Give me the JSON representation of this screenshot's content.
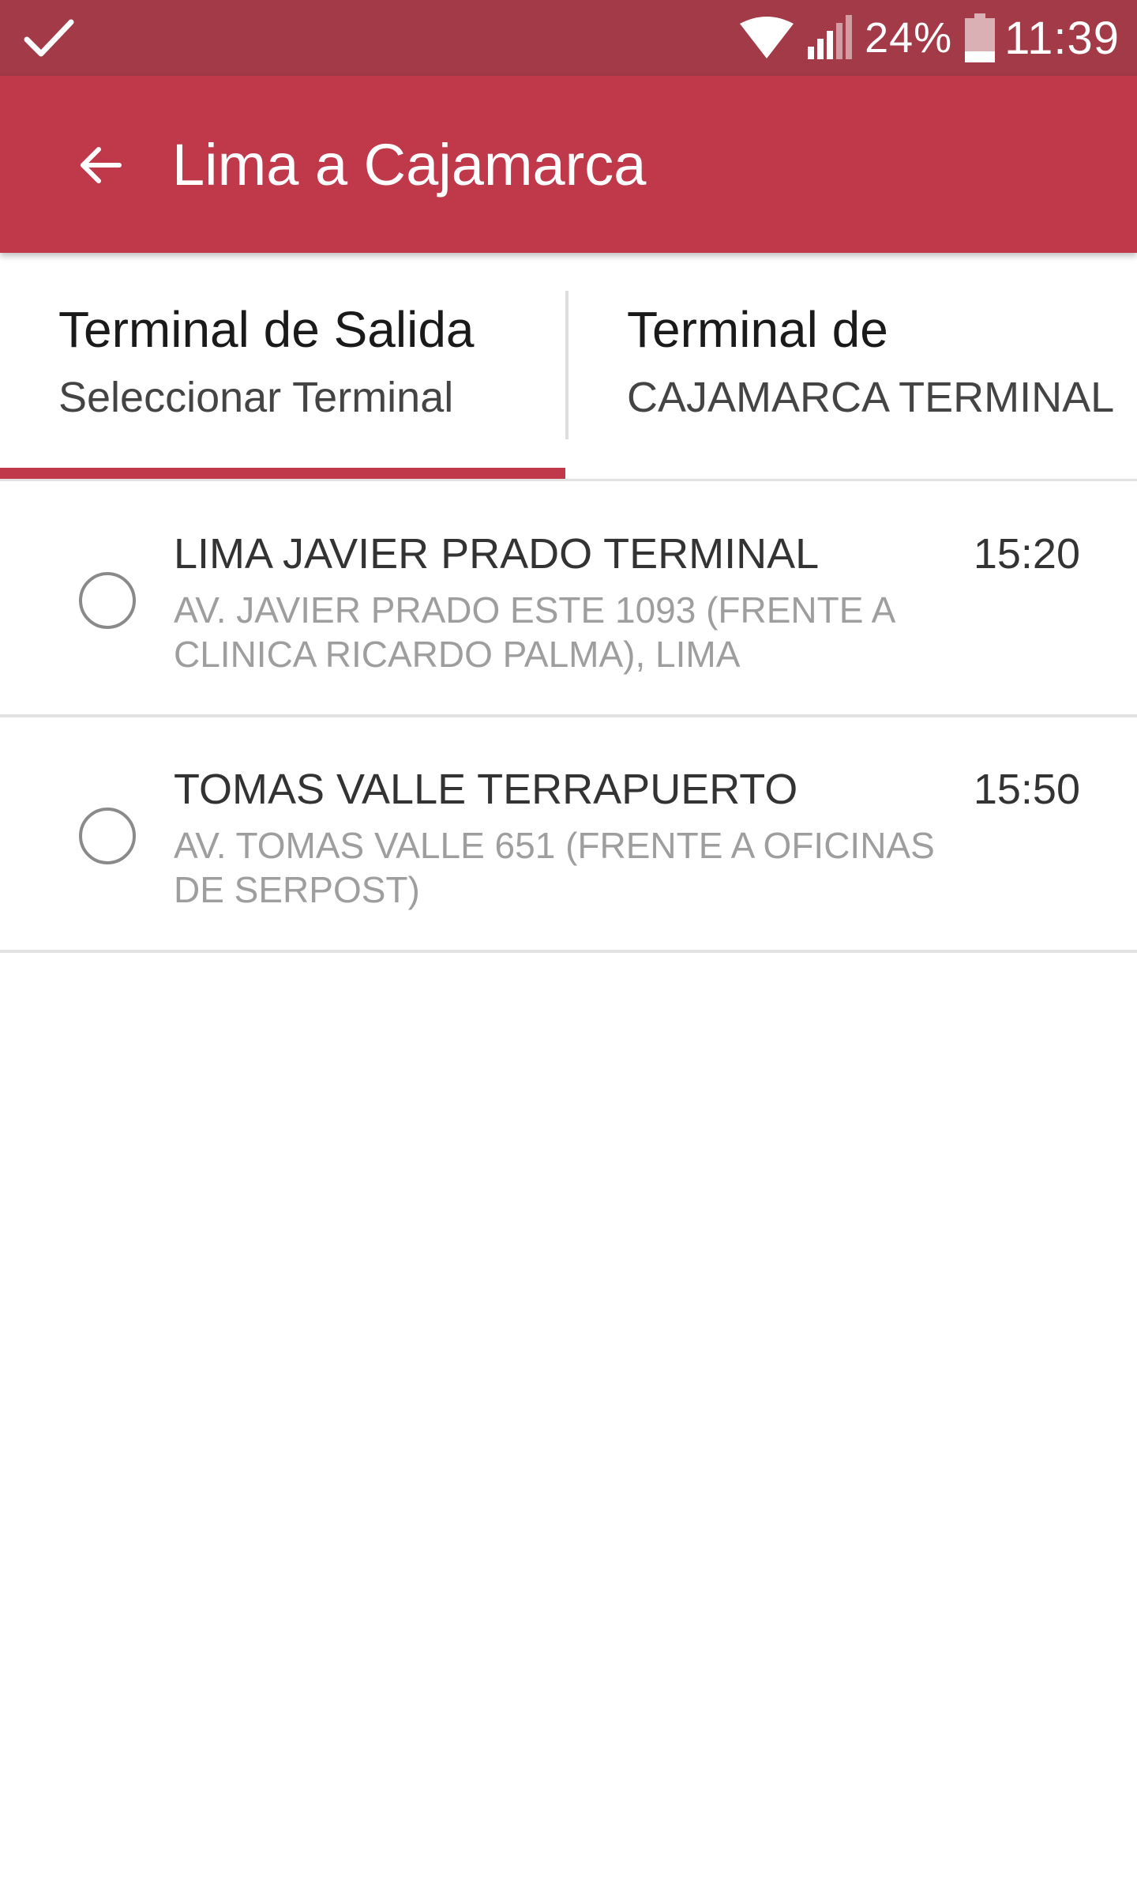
{
  "status_bar": {
    "battery_percent": "24%",
    "time": "11:39",
    "left_icon": "check-icon",
    "icons": [
      "wifi-icon",
      "signal-icon",
      "battery-icon"
    ]
  },
  "app_bar": {
    "title": "Lima a Cajamarca",
    "back_icon": "arrow-back-icon",
    "color": "#c0394a"
  },
  "tabs": [
    {
      "title": "Terminal de Salida",
      "subtitle": "Seleccionar Terminal",
      "selected": true
    },
    {
      "title": "Terminal de",
      "subtitle": "CAJAMARCA TERMINAL",
      "selected": false
    }
  ],
  "terminals": [
    {
      "name": "LIMA JAVIER PRADO TERMINAL",
      "address": "AV. JAVIER PRADO ESTE 1093 (FRENTE A CLINICA RICARDO PALMA), LIMA",
      "time": "15:20",
      "selected": false
    },
    {
      "name": "TOMAS VALLE TERRAPUERTO",
      "address": "AV. TOMAS VALLE 651 (FRENTE A OFICINAS DE SERPOST)",
      "time": "15:50",
      "selected": false
    }
  ],
  "colors": {
    "status_bar": "#a23a47",
    "accent": "#c0394a"
  }
}
